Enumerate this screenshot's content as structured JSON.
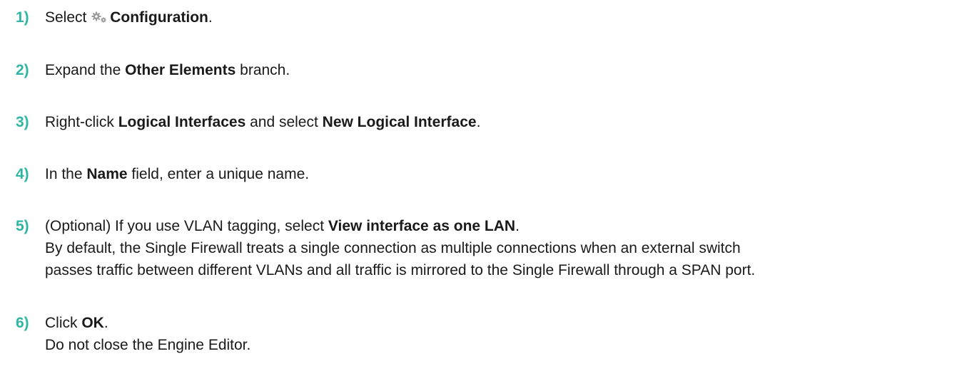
{
  "steps": [
    {
      "number": "1)",
      "parts": {
        "a": "Select",
        "b": "Configuration",
        "c": "."
      },
      "icon": "gear-icon"
    },
    {
      "number": "2)",
      "parts": {
        "a": "Expand the ",
        "b": "Other Elements",
        "c": " branch."
      }
    },
    {
      "number": "3)",
      "parts": {
        "a": "Right-click ",
        "b": "Logical Interfaces",
        "c": " and select ",
        "d": "New Logical Interface",
        "e": "."
      }
    },
    {
      "number": "4)",
      "parts": {
        "a": "In the ",
        "b": "Name",
        "c": " field, enter a unique name."
      }
    },
    {
      "number": "5)",
      "parts": {
        "a": "(Optional) If you use VLAN tagging, select ",
        "b": "View interface as one LAN",
        "c": "."
      },
      "detail": [
        "By default, the Single Firewall treats a single connection as multiple connections when an external switch",
        "passes traffic between different VLANs and all traffic is mirrored to the Single Firewall through a SPAN port."
      ]
    },
    {
      "number": "6)",
      "parts": {
        "a": "Click ",
        "b": "OK",
        "c": "."
      },
      "detail": [
        "Do not close the Engine Editor."
      ]
    }
  ],
  "colors": {
    "step_number": "#2fb5a3",
    "text": "#1a1a1a",
    "icon": "#9a9a9a"
  }
}
